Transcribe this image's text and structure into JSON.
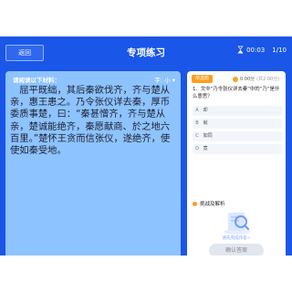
{
  "header": {
    "back_label": "返回",
    "title": "专项练习",
    "timer": "00:03",
    "progress": "1/10"
  },
  "reading": {
    "title": "请阅读以下材料：",
    "font_size_label": "字: 小 ▾",
    "passage": "　屈平既绌，其后秦欲伐齐，齐与楚从亲，惠王患之。乃令张仪详去秦，厚币委质事楚，曰：“秦甚憎齐，齐与楚从亲，楚诚能绝齐，秦愿献商、於之地六百里。”楚怀王贪而信张仪，遂绝齐，使使如秦受地。"
  },
  "question_card": {
    "tag": "单选题",
    "score": "0.00分",
    "score_max": "(共2.00分)",
    "question": "1、文中“乃令张仪详去秦”中的“乃”是什么意思？",
    "options": [
      {
        "letter": "A",
        "text": "却"
      },
      {
        "letter": "B",
        "text": "就"
      },
      {
        "letter": "C",
        "text": "如同"
      },
      {
        "letter": "D",
        "text": "竟"
      }
    ],
    "explain_label": "挑战及解析",
    "explain_hint": "请先完成作答~",
    "confirm_label": "确认答案"
  },
  "colors": {
    "background": "#1a56e8",
    "reading_panel": "#8dc3ff",
    "tag": "#ff9d1e"
  }
}
